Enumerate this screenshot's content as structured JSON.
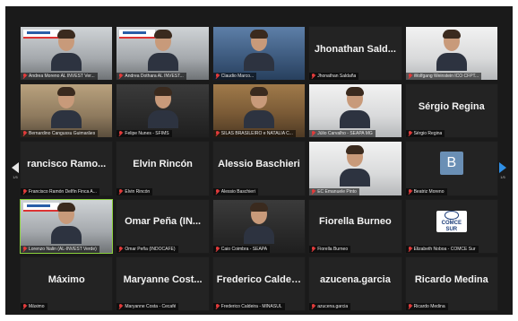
{
  "navigation": {
    "left_page": "1/5",
    "right_page": "1/5",
    "accent": "#2f8fe6"
  },
  "tiles": [
    {
      "type": "video",
      "video_style": "office",
      "banner": true,
      "label": "Andrea Moreno AL INVEST Ver..."
    },
    {
      "type": "video",
      "video_style": "office",
      "banner": true,
      "label": "Andrea Dothara AL INVEST..."
    },
    {
      "type": "video",
      "video_style": "blue",
      "banner": false,
      "label": "Claudio Marco..."
    },
    {
      "type": "name",
      "name": "Jhonathan Sald...",
      "label": "Jhonathan Saldaña"
    },
    {
      "type": "video",
      "video_style": "bright",
      "banner": false,
      "label": "Wolfgang Weinstein ICO CFPT..."
    },
    {
      "type": "video",
      "video_style": "warm",
      "banner": false,
      "label": "Bernardino Cangussu Guimarães"
    },
    {
      "type": "video",
      "video_style": "dark",
      "banner": false,
      "label": "Felipe Nunes - SFIMS"
    },
    {
      "type": "video",
      "video_style": "wood",
      "banner": false,
      "label": "SILAS BRASILEIRO e NATALIA C..."
    },
    {
      "type": "video",
      "video_style": "bright",
      "banner": false,
      "label": "Júlio Carvalho - SEAPA MG"
    },
    {
      "type": "name",
      "name": "Sérgio Regina",
      "label": "Sérgio Regina"
    },
    {
      "type": "name",
      "name": "rancisco Ramo...",
      "label": "Francisco Ramón Delfín Finca A..."
    },
    {
      "type": "name",
      "name": "Elvin Rincón",
      "label": "Elvin Rincón"
    },
    {
      "type": "name",
      "name": "Alessio Baschieri",
      "label": "Alessio Baschieri"
    },
    {
      "type": "video",
      "video_style": "bright",
      "banner": false,
      "label": "EC Emanuele Pinto"
    },
    {
      "type": "avatar",
      "avatar": "B",
      "label": "Beatriz Moreno"
    },
    {
      "type": "video",
      "video_style": "office",
      "banner": true,
      "speaking": true,
      "label": "Lorenzo Nalin (AL-INVEST Verde)"
    },
    {
      "type": "name",
      "name": "Omar Peña (IN...",
      "label": "Omar Peña (INDOCAFE)"
    },
    {
      "type": "video",
      "video_style": "dark",
      "banner": false,
      "label": "Caio Coimbra - SEAPA"
    },
    {
      "type": "name",
      "name": "Fiorella Burneo",
      "label": "Fiorella Burneo"
    },
    {
      "type": "logo",
      "logo_text": "COMCE",
      "logo_sub": "SUR",
      "label": "Elizabeth Noboa - COMCE Sur"
    },
    {
      "type": "name",
      "name": "Máximo",
      "label": "Máximo"
    },
    {
      "type": "name",
      "name": "Maryanne Cost...",
      "label": "Maryanne Costa - Cecafé"
    },
    {
      "type": "name",
      "name": "Frederico Caldei...",
      "label": "Frederico Caldeira - MINASUL"
    },
    {
      "type": "name",
      "name": "azucena.garcia",
      "label": "azucena.garcia"
    },
    {
      "type": "name",
      "name": "Ricardo Medina",
      "label": "Ricardo Medina"
    }
  ]
}
